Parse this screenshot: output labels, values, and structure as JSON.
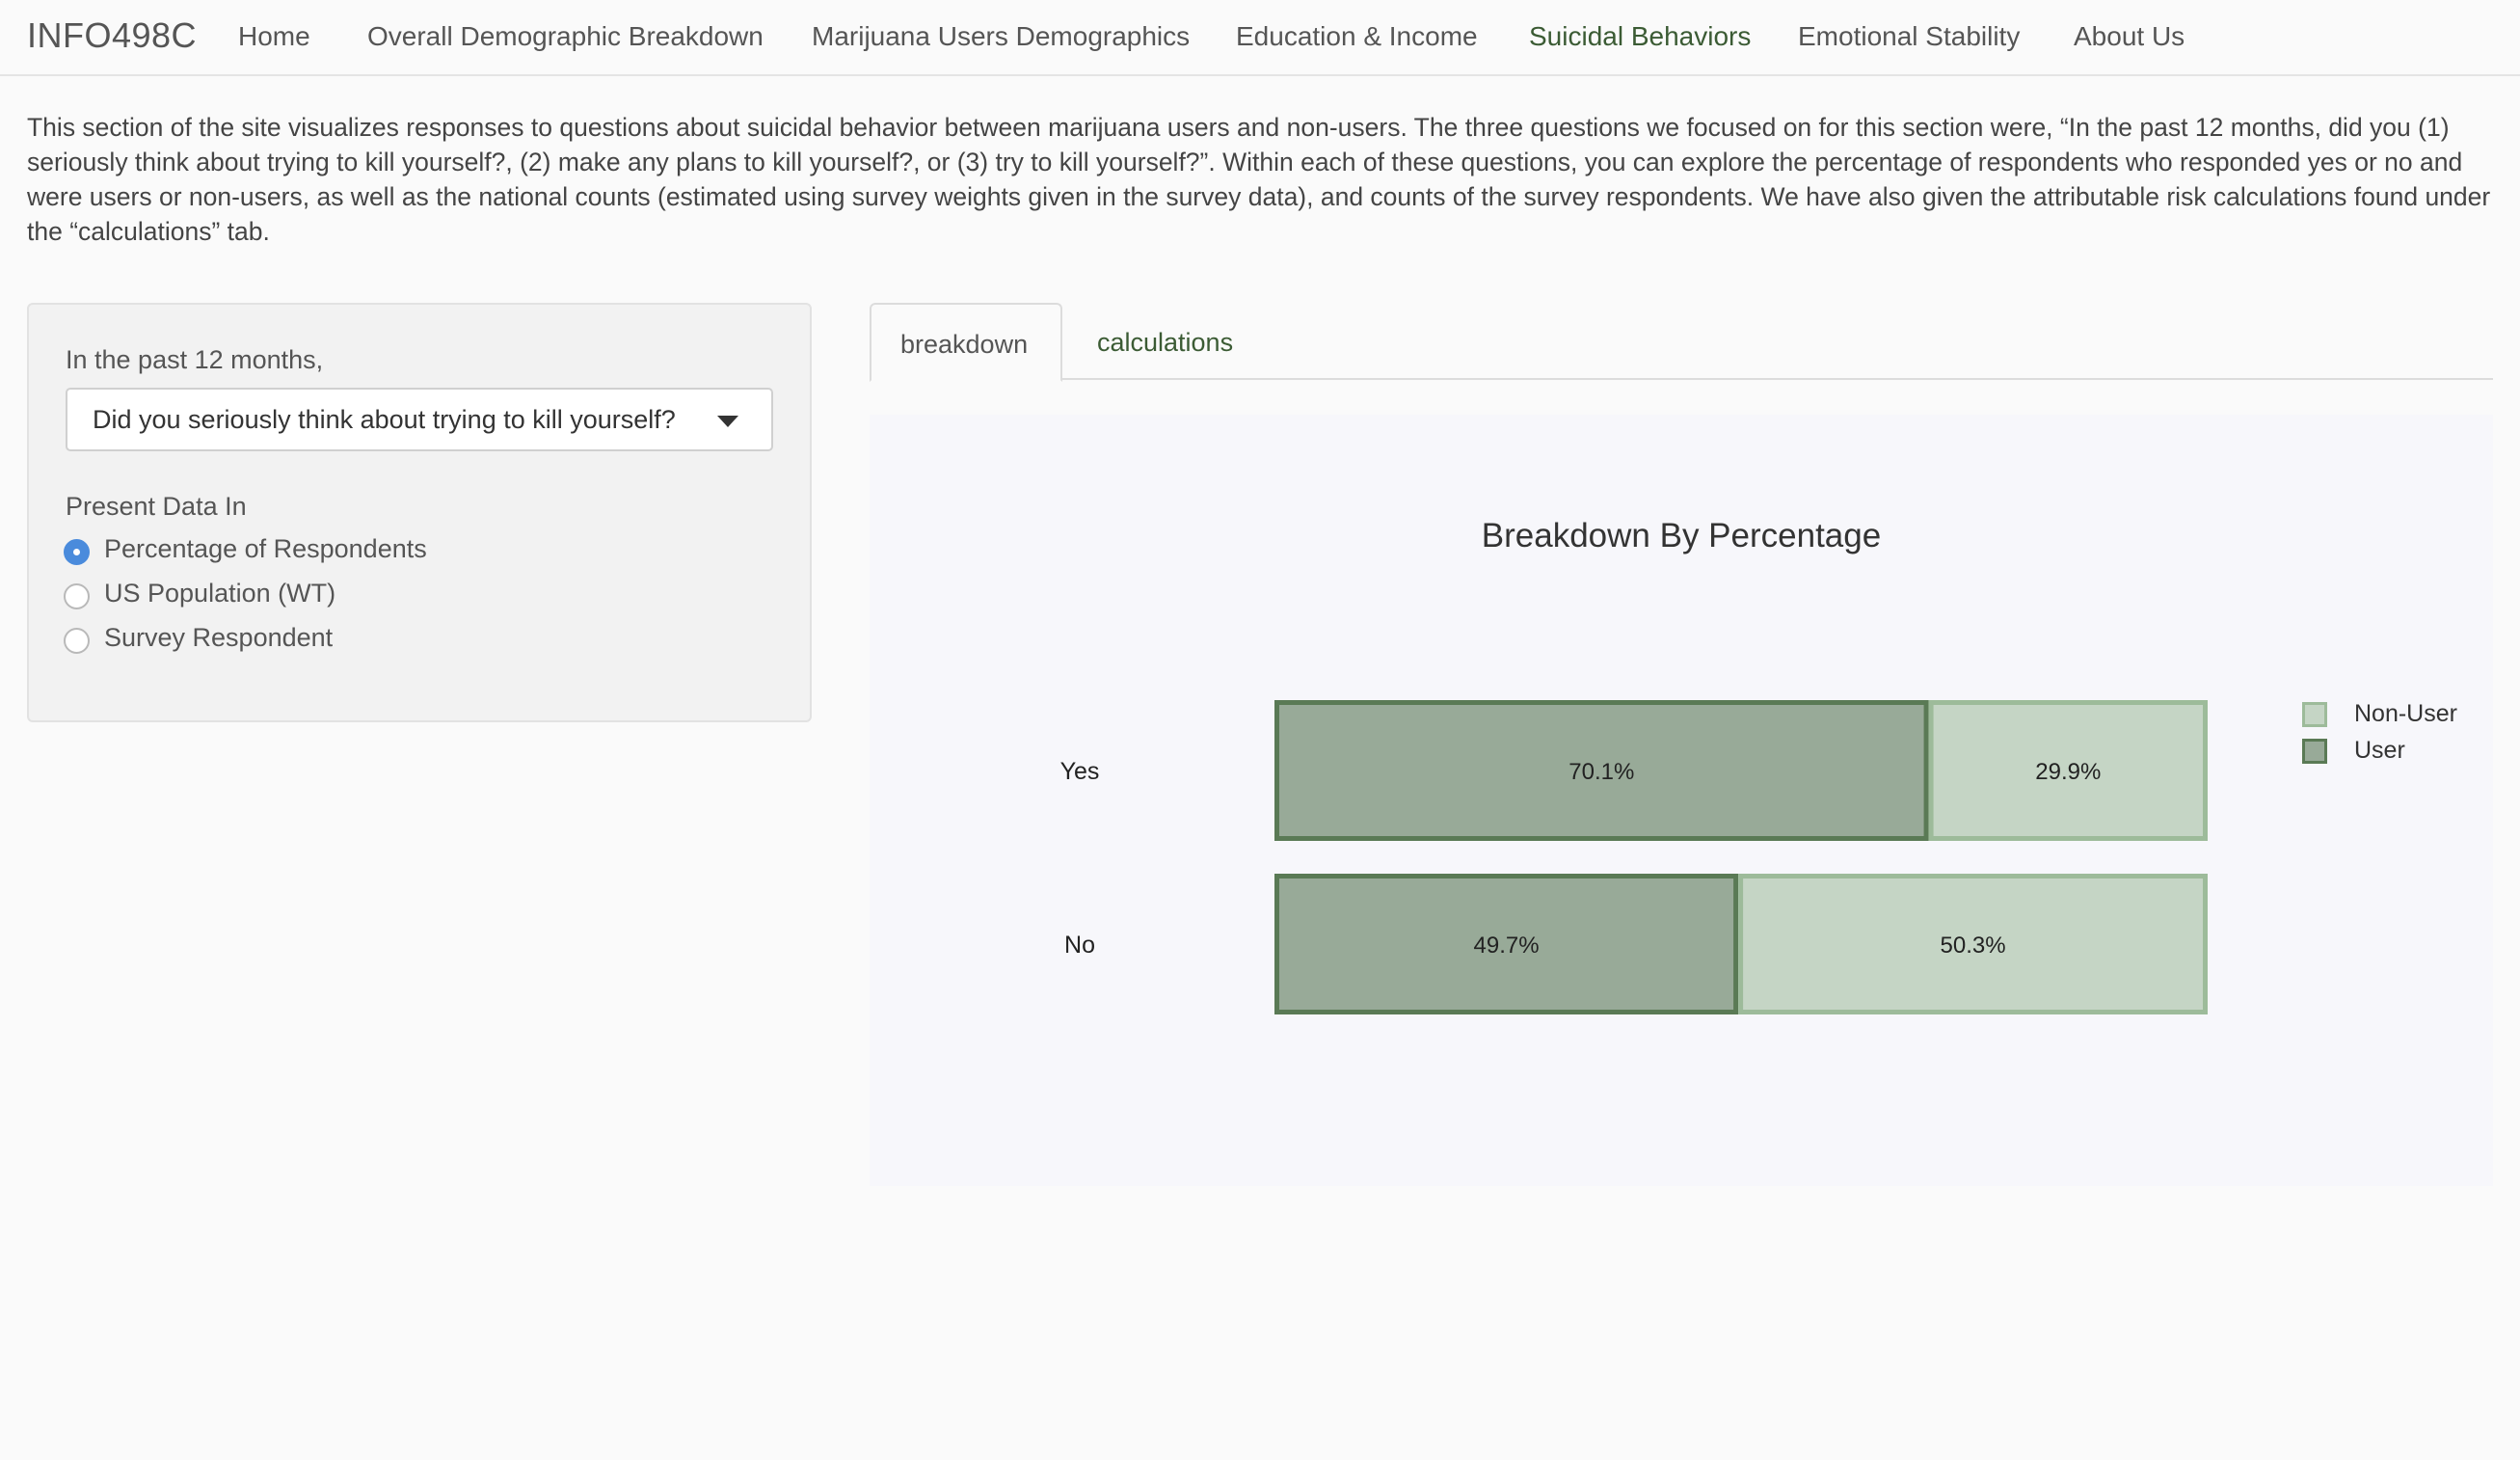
{
  "nav": {
    "brand": "INFO498C",
    "items": [
      {
        "label": "Home",
        "active": false
      },
      {
        "label": "Overall Demographic Breakdown",
        "active": false
      },
      {
        "label": "Marijuana Users Demographics",
        "active": false
      },
      {
        "label": "Education & Income",
        "active": false
      },
      {
        "label": "Suicidal Behaviors",
        "active": true
      },
      {
        "label": "Emotional Stability",
        "active": false
      },
      {
        "label": "About Us",
        "active": false
      }
    ]
  },
  "intro": {
    "text": "This section of the site visualizes responses to questions about suicidal behavior between marijuana users and non-users. The three questions we focused on for this section were, “In the past 12 months, did you (1) seriously think about trying to kill yourself?, (2) make any plans to kill yourself?, or (3) try to kill yourself?”. Within each of these questions, you can explore the percentage of respondents who responded yes or no and were users or non-users, as well as the national counts (estimated using survey weights given in the survey data), and counts of the survey respondents. We have also given the attributable risk calculations found under the “calculations” tab."
  },
  "sidebar": {
    "question_label": "In the past 12 months,",
    "question_select": {
      "value": "Did you seriously think about trying to kill yourself?"
    },
    "present_label": "Present Data In",
    "radios": [
      {
        "label": "Percentage of Respondents",
        "checked": true
      },
      {
        "label": "US Population (WT)",
        "checked": false
      },
      {
        "label": "Survey Respondent",
        "checked": false
      }
    ]
  },
  "tabs": [
    {
      "label": "breakdown",
      "active": true
    },
    {
      "label": "calculations",
      "active": false
    }
  ],
  "colors": {
    "user_fill": "#98aa98",
    "user_border": "#5a7a55",
    "nonuser_fill": "#c5d5c5",
    "nonuser_border": "#9dbb9a"
  },
  "chart_data": {
    "type": "bar",
    "orientation": "horizontal",
    "stacked": true,
    "title": "Breakdown By Percentage",
    "categories": [
      "Yes",
      "No"
    ],
    "series": [
      {
        "name": "User",
        "values": [
          70.1,
          49.7
        ],
        "labels": [
          "70.1%",
          "49.7%"
        ]
      },
      {
        "name": "Non-User",
        "values": [
          29.9,
          50.3
        ],
        "labels": [
          "29.9%",
          "50.3%"
        ]
      }
    ],
    "xlim": [
      0,
      100
    ],
    "legend_position": "top-right",
    "legend": [
      "Non-User",
      "User"
    ],
    "grid": false
  }
}
